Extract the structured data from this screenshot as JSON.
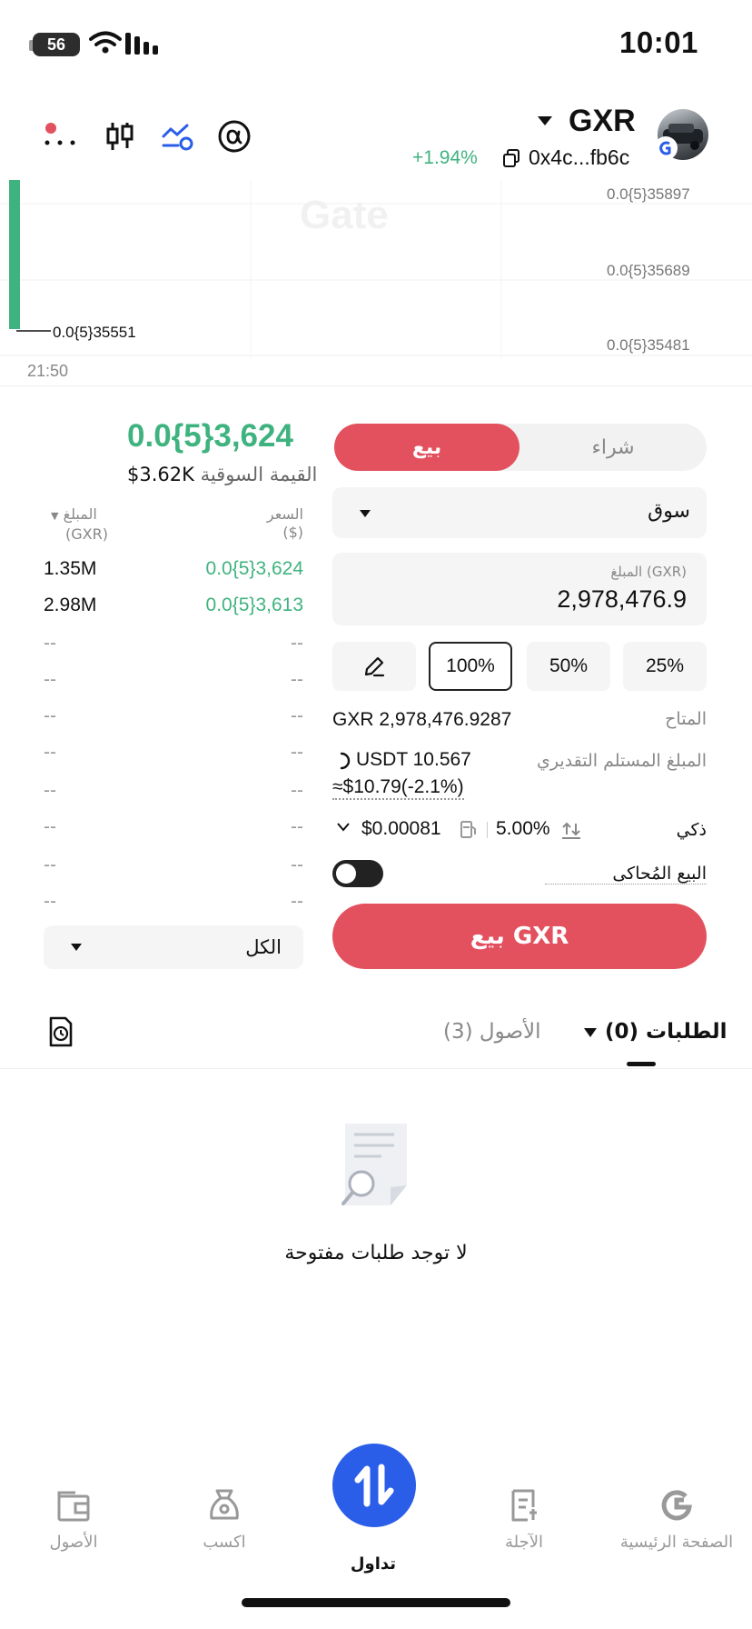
{
  "status_bar": {
    "time": "10:01",
    "battery": "56"
  },
  "header": {
    "pair": "GXR",
    "change": "+1.94%",
    "address": "0x4c...fb6c",
    "icons": [
      "more-dots-icon",
      "candlestick-icon",
      "trend-icon",
      "alpha-icon"
    ]
  },
  "chart": {
    "watermark": "Gate",
    "price_labels": [
      "0.0{5}35897",
      "0.0{5}35689",
      "0.0{5}35481"
    ],
    "marker_price": "0.0{5}35551",
    "time_label": "21:50"
  },
  "order_book": {
    "last_price": "0.0{5}3,624",
    "market_cap_label": "القيمة السوقية",
    "market_cap": "$3.62K",
    "price_header": "السعر",
    "price_unit": "($)",
    "amount_header": "المبلغ",
    "amount_unit": "(GXR)",
    "rows": [
      {
        "price": "0.0{5}3,624",
        "amount": "1.35M"
      },
      {
        "price": "0.0{5}3,613",
        "amount": "2.98M"
      },
      {
        "price": "--",
        "amount": "--"
      },
      {
        "price": "--",
        "amount": "--"
      },
      {
        "price": "--",
        "amount": "--"
      },
      {
        "price": "--",
        "amount": "--"
      },
      {
        "price": "--",
        "amount": "--"
      },
      {
        "price": "--",
        "amount": "--"
      },
      {
        "price": "--",
        "amount": "--"
      },
      {
        "price": "--",
        "amount": "--"
      }
    ],
    "filter": "الكل"
  },
  "order_form": {
    "buy_tab": "شراء",
    "sell_tab": "بيع",
    "order_type": "سوق",
    "amount_label": "المبلغ (GXR)",
    "amount_value": "2,978,476.9",
    "percentages": [
      "25%",
      "50%",
      "100%"
    ],
    "available_label": "المتاح",
    "available_value": "GXR 2,978,476.9287",
    "estimate_label": "المبلغ المستلم التقديري",
    "estimate_value": "USDT 10.567",
    "estimate_usd": "≈$10.79(-2.1%)",
    "smart_label": "ذكي",
    "slippage": "5.00%",
    "fee": "$0.00081",
    "simulated_label": "البيع المُحاكى",
    "sell_button": "بيع GXR"
  },
  "tabs": {
    "orders": "الطلبات (0)",
    "assets": "الأصول (3)"
  },
  "empty_state": "لا توجد طلبات مفتوحة",
  "bottom_nav": {
    "home": "الصفحة الرئيسية",
    "futures": "الآجلة",
    "trade": "تداول",
    "earn": "اكسب",
    "assets": "الأصول"
  },
  "colors": {
    "green": "#3fb37f",
    "red": "#e3515f",
    "blue": "#2a5ee8"
  }
}
